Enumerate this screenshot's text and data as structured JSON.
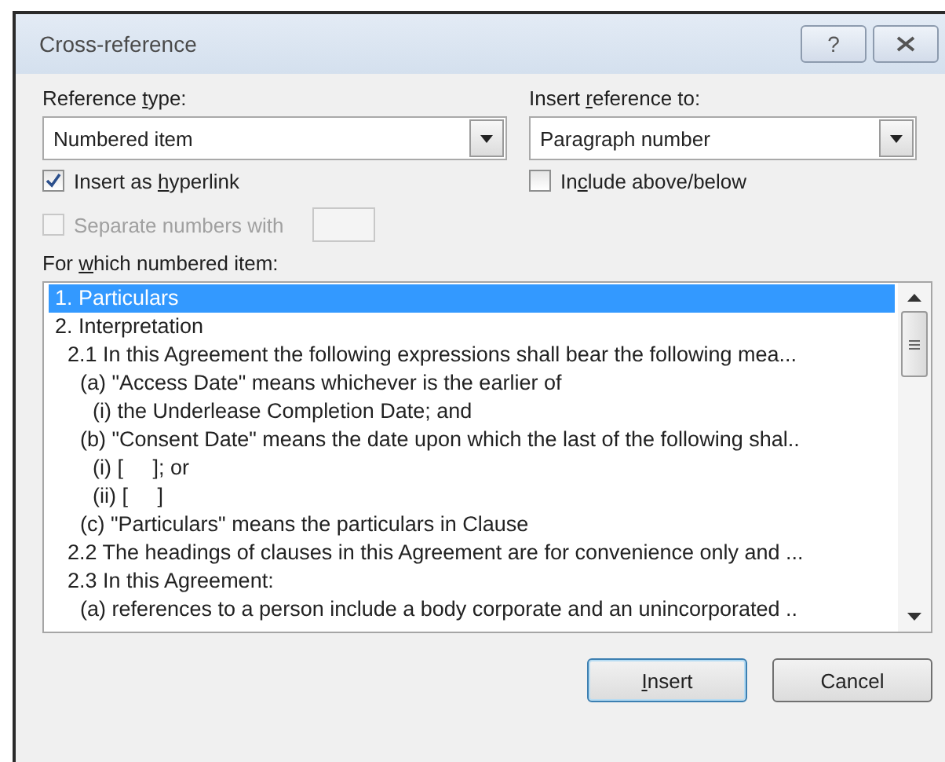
{
  "window": {
    "title": "Cross-reference",
    "controls": [
      {
        "kind": "help",
        "label": "?"
      },
      {
        "kind": "close"
      }
    ]
  },
  "reference_type": {
    "label": {
      "pre": "Reference ",
      "key": "t",
      "post": "ype:"
    },
    "value": "Numbered item"
  },
  "insert_reference_to": {
    "label": {
      "pre": "Insert ",
      "key": "r",
      "post": "eference to:"
    },
    "value": "Paragraph number"
  },
  "checkboxes": [
    {
      "label": {
        "pre": "Insert as ",
        "key": "h",
        "post": "yperlink"
      },
      "checked": true,
      "disabled": false
    },
    {
      "label": {
        "pre": "In",
        "key": "c",
        "post": "lude above/below"
      },
      "checked": false,
      "disabled": false
    }
  ],
  "separate_numbers": {
    "label": {
      "pre": "Separate numbers with"
    },
    "checked": false,
    "disabled": true
  },
  "list": {
    "label": {
      "pre": "For ",
      "key": "w",
      "post": "hich numbered item:"
    },
    "items": [
      {
        "text": "1. Particulars",
        "selected": true
      },
      {
        "text": "2. Interpretation",
        "selected": false,
        "children": [
          {
            "text": "2.1 In this Agreement the following expressions shall bear the following mea...",
            "selected": false,
            "children": [
              {
                "text": "(a) \"Access Date\" means whichever is the earlier of",
                "selected": false,
                "children": [
                  {
                    "text": "(i) the Underlease Completion Date; and",
                    "selected": false
                  }
                ]
              },
              {
                "text": "(b) \"Consent Date\" means the date upon which the last of the following shal..",
                "selected": false,
                "children": [
                  {
                    "text": "(i) [     ]; or",
                    "selected": false
                  },
                  {
                    "text": "(ii) [     ]",
                    "selected": false
                  }
                ]
              },
              {
                "text": "(c) \"Particulars\" means the particulars in Clause",
                "selected": false
              }
            ]
          },
          {
            "text": "2.2 The headings of clauses in this Agreement are for convenience only and ...",
            "selected": false
          },
          {
            "text": "2.3 In this Agreement:",
            "selected": false,
            "children": [
              {
                "text": "(a) references to a person include a body corporate and an unincorporated ..",
                "selected": false
              }
            ]
          }
        ]
      }
    ]
  },
  "buttons": [
    {
      "label": {
        "key": "I",
        "post": "nsert"
      },
      "default": true
    },
    {
      "label": {
        "pre": "Cancel"
      },
      "default": false
    }
  ]
}
